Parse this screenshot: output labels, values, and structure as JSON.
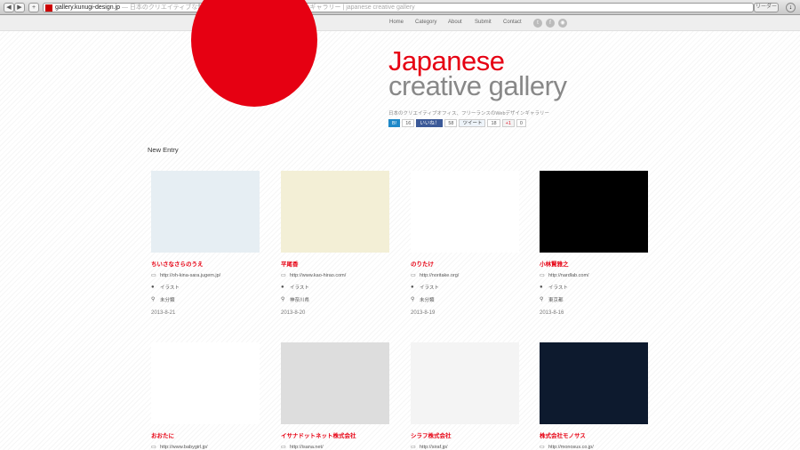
{
  "browser": {
    "url_domain": "gallery.kunugi-design.jp",
    "page_title": "— 日本のクリエイティブな制作会社・フリーランスのWebデザインギャラリー | japanese creative gallery",
    "reader_label": "リーダー",
    "back": "◀",
    "forward": "▶",
    "add": "+"
  },
  "nav": {
    "items": [
      "Home",
      "Category",
      "About",
      "Submit",
      "Contact"
    ],
    "social": [
      "twitter-icon",
      "facebook-icon",
      "rss-icon"
    ]
  },
  "header": {
    "title_line1": "Japanese",
    "title_line2": "creative gallery",
    "subtitle": "日本のクリエイティブオフィス、フリーランスのWebデザインギャラリー",
    "share": {
      "hatena_label": "B!",
      "hatena_count": "16",
      "fb_label": "いいね！",
      "fb_count": "58",
      "tweet_label": "ツイート",
      "tweet_count": "18",
      "gplus_label": "+1",
      "gplus_count": "0"
    }
  },
  "section_title": "New Entry",
  "entries": [
    {
      "name": "ちいさなさらのうえ",
      "url": "http://oh-kina-sara.jugem.jp/",
      "category": "イラスト",
      "location": "未分類",
      "date": "2013-8-21",
      "thumb": "#e6eef3"
    },
    {
      "name": "平尾香",
      "url": "http://www.kao-hirao.com/",
      "category": "イラスト",
      "location": "神奈川県",
      "date": "2013-8-20",
      "thumb": "#f3efd6"
    },
    {
      "name": "のりたけ",
      "url": "http://noritake.org/",
      "category": "イラスト",
      "location": "未分類",
      "date": "2013-8-19",
      "thumb": "#ffffff"
    },
    {
      "name": "小林賢雅之",
      "url": "http://nardlab.com/",
      "category": "イラスト",
      "location": "東京都",
      "date": "2013-8-16",
      "thumb": "#000000"
    },
    {
      "name": "おおたに",
      "url": "http://www.babygirl.jp/",
      "thumb": "#ffffff"
    },
    {
      "name": "イサナドットネット株式会社",
      "url": "http://isana.net/",
      "thumb": "#dddddd"
    },
    {
      "name": "シラフ株式会社",
      "url": "http://siraf.jp/",
      "thumb": "#f4f4f4"
    },
    {
      "name": "株式会社モノサス",
      "url": "http://monosus.co.jp/",
      "thumb": "#0d1a2e"
    }
  ]
}
